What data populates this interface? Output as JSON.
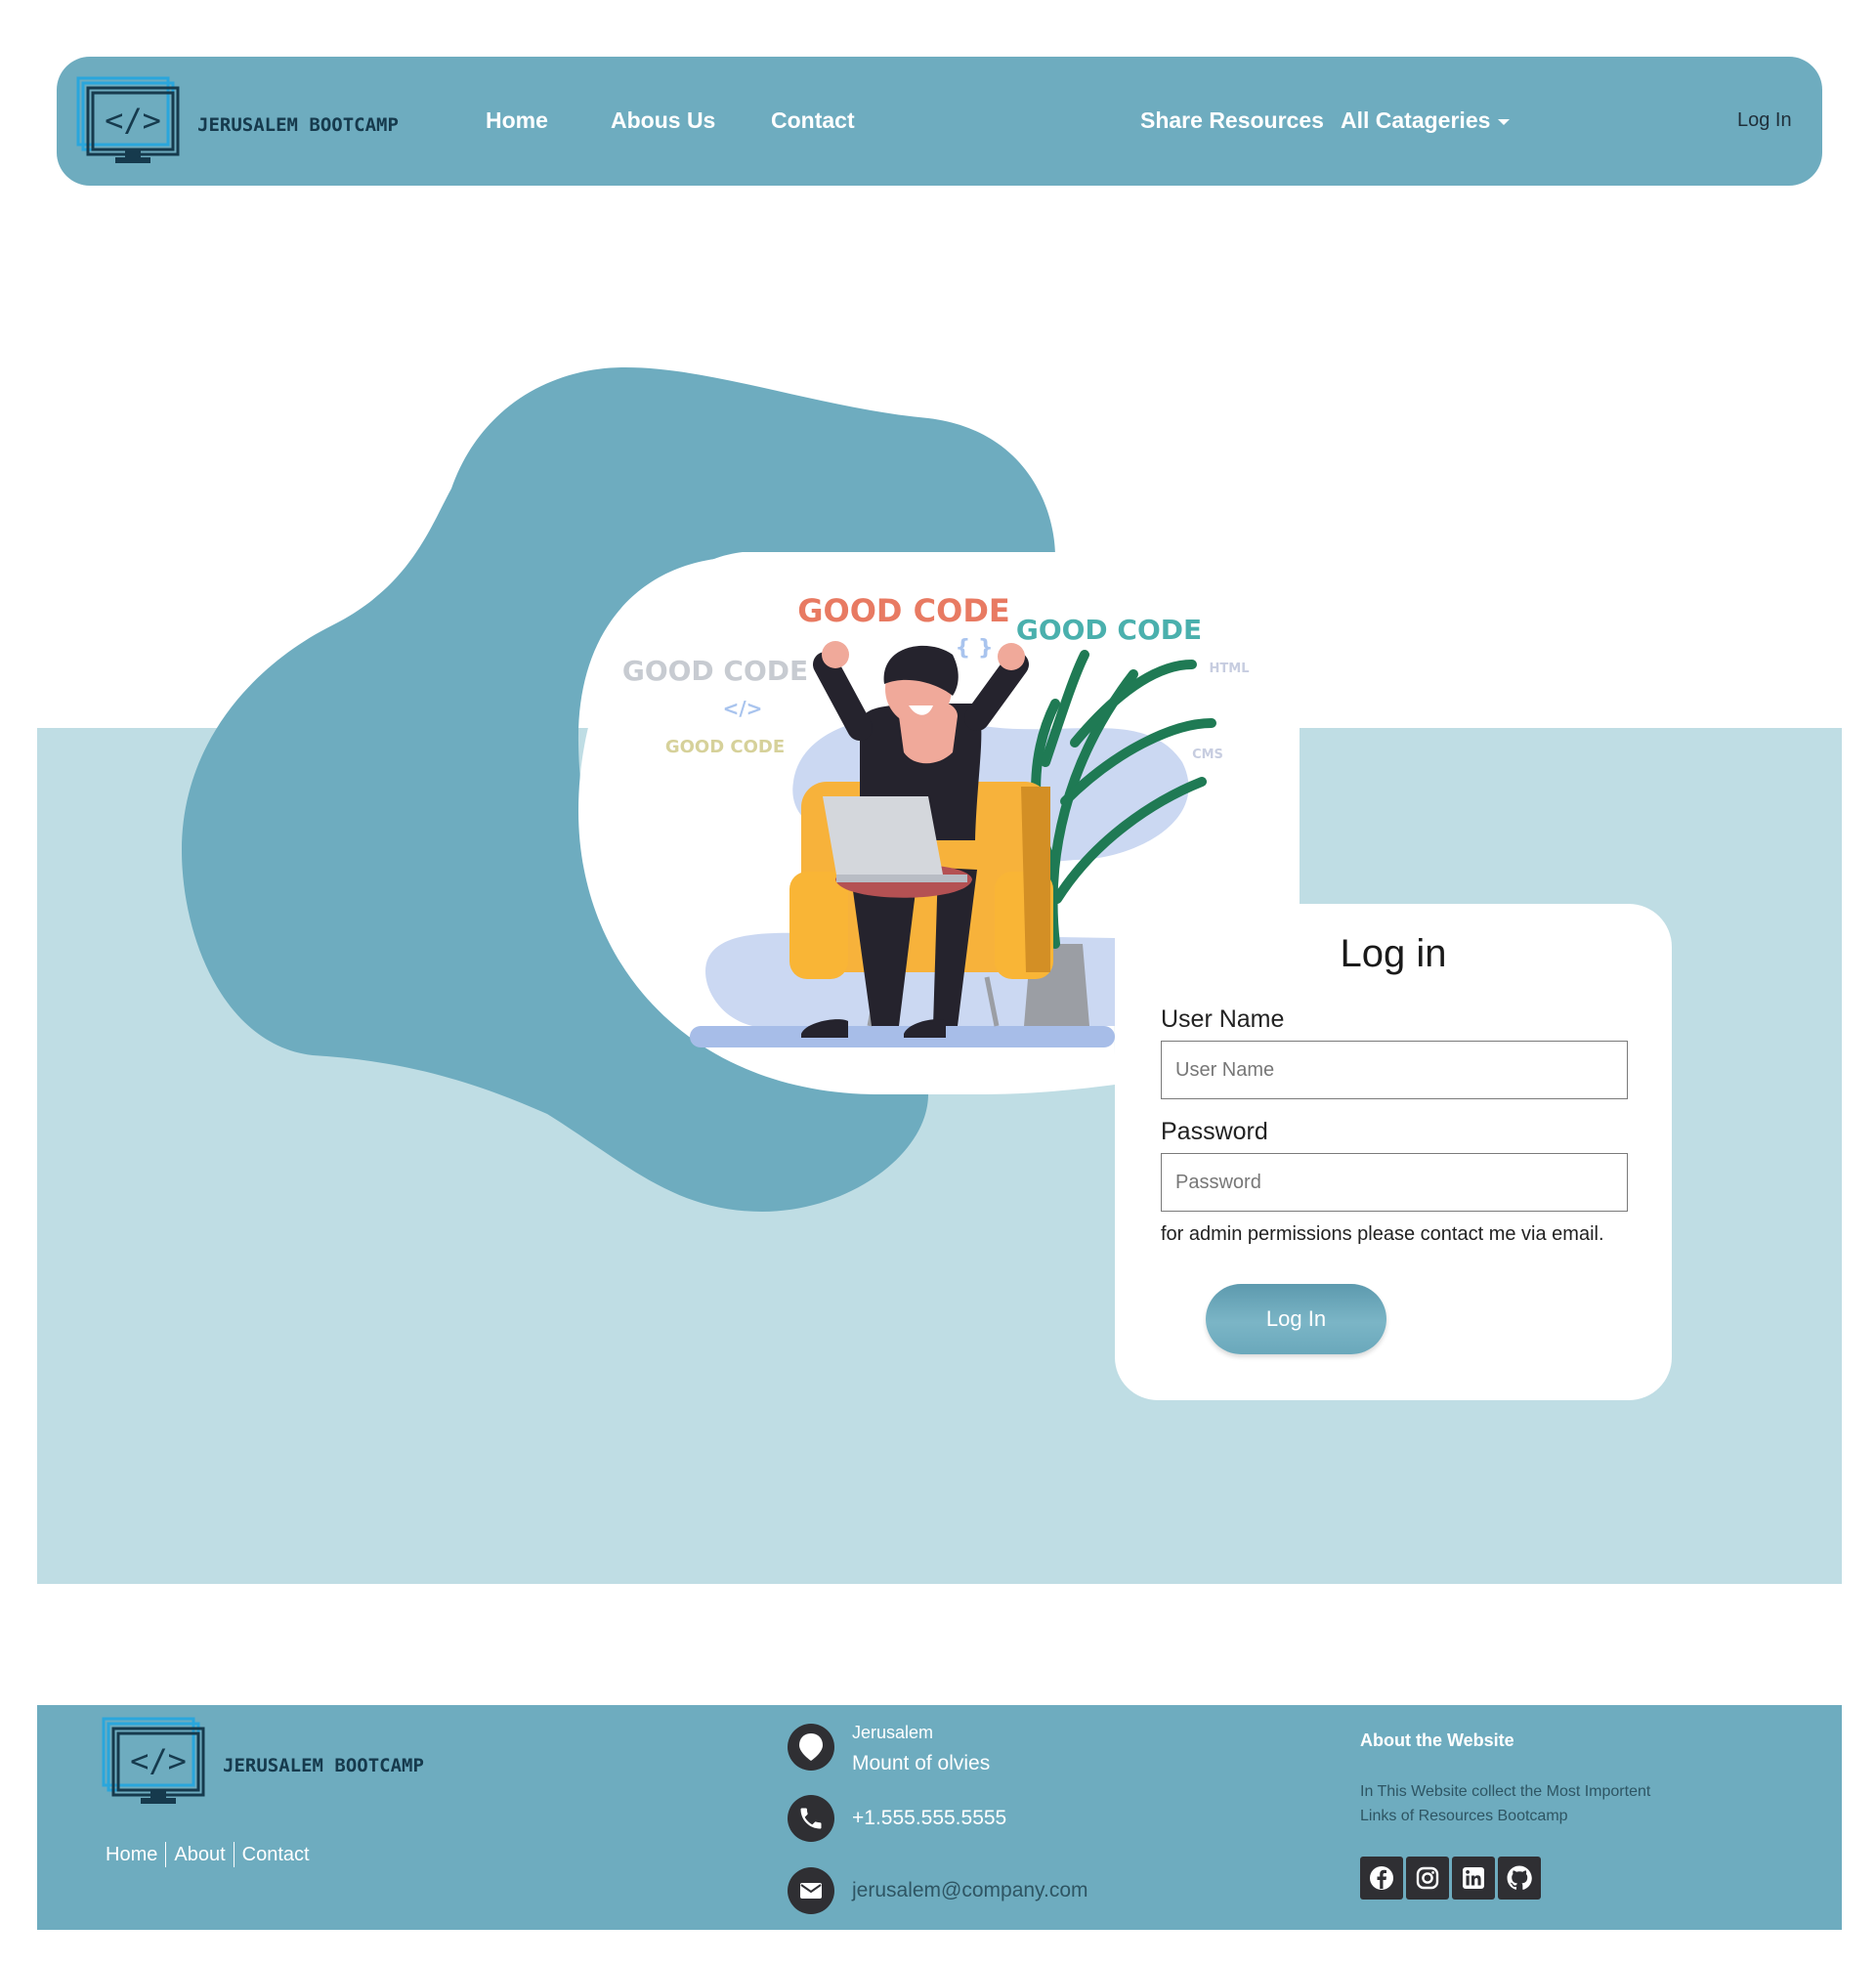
{
  "brand": {
    "name": "JERUSALEM BOOTCAMP",
    "logo_code": "</>"
  },
  "nav": {
    "home": "Home",
    "about": "Abous Us",
    "contact": "Contact",
    "share": "Share Resources",
    "categories": "All Catageries",
    "login": "Log In"
  },
  "illustration": {
    "words": [
      "GOOD CODE",
      "GOOD CODE",
      "GOOD CODE",
      "GOOD CODE",
      "{ }",
      "</>",
      "HTML",
      "CMS"
    ]
  },
  "login": {
    "title": "Log in",
    "username_label": "User Name",
    "username_placeholder": "User Name",
    "password_label": "Password",
    "password_placeholder": "Password",
    "note": "for admin permissions please contact me via email.",
    "button": "Log In"
  },
  "footer": {
    "nav": [
      "Home",
      "About",
      "Contact"
    ],
    "location_city": "Jerusalem",
    "location_place": "Mount of olvies",
    "phone": "+1.555.555.5555",
    "email": "jerusalem@company.com",
    "about_title": "About the Website",
    "about_text": "In This Website collect the Most Importent Links of Resources Bootcamp",
    "social_icons": [
      "facebook-icon",
      "instagram-icon",
      "linkedin-icon",
      "github-icon"
    ]
  },
  "colors": {
    "primary": "#6eacbf",
    "hero_band": "#bfdde4",
    "dark": "#2f2f33",
    "blob": "#6eacbf"
  }
}
